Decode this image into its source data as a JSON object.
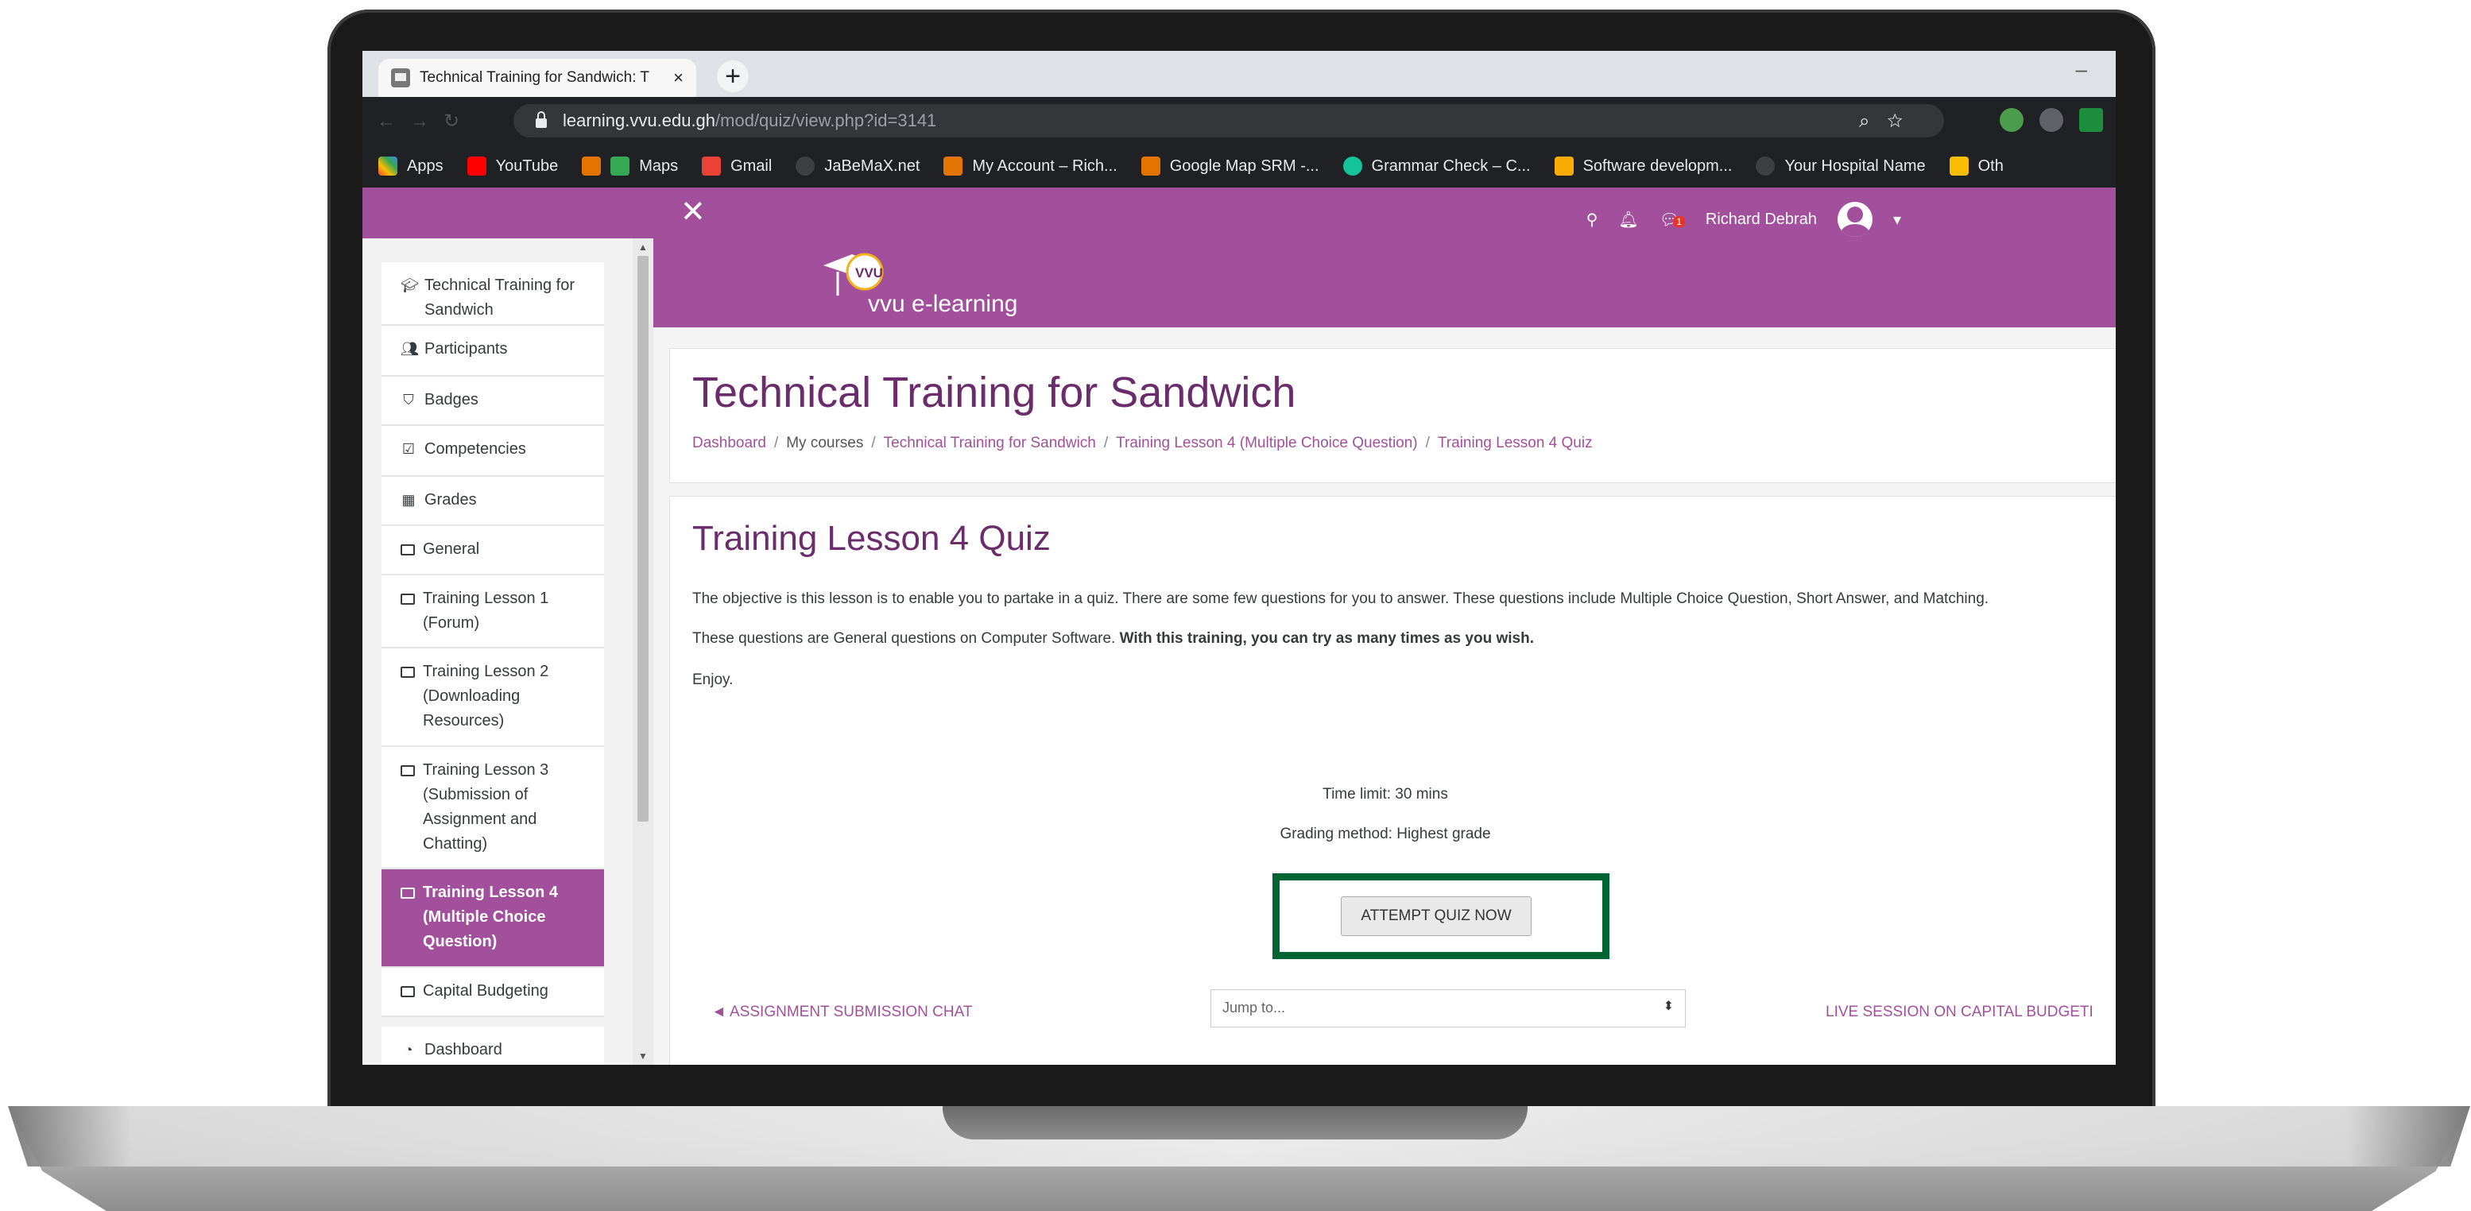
{
  "browser": {
    "tab_title": "Technical Training for Sandwich: T",
    "url_host": "learning.vvu.edu.gh",
    "url_path": "/mod/quiz/view.php?id=3141",
    "bookmarks": [
      "Apps",
      "YouTube",
      "Maps",
      "Gmail",
      "JaBeMaX.net",
      "My Account – Rich...",
      "Google Map SRM -...",
      "Grammar Check – C...",
      "Software developm...",
      "Your Hospital Name",
      "Oth"
    ]
  },
  "navbar": {
    "close_glyph": "✕",
    "user_name": "Richard Debrah",
    "message_count": "1"
  },
  "site": {
    "logo_badge": "VVU",
    "logo_text": "vvu e-learning"
  },
  "sidebar": {
    "items": [
      {
        "label": "Technical Training for Sandwich",
        "icon": "graduation-cap-icon"
      },
      {
        "label": "Participants",
        "icon": "users-icon"
      },
      {
        "label": "Badges",
        "icon": "shield-icon"
      },
      {
        "label": "Competencies",
        "icon": "checkbox-icon"
      },
      {
        "label": "Grades",
        "icon": "table-icon"
      },
      {
        "label": "General",
        "icon": "folder-icon"
      },
      {
        "label": "Training Lesson 1 (Forum)",
        "icon": "folder-icon"
      },
      {
        "label": "Training Lesson 2 (Downloading Resources)",
        "icon": "folder-icon"
      },
      {
        "label": "Training Lesson 3 (Submission of Assignment and Chatting)",
        "icon": "folder-icon"
      },
      {
        "label": "Training Lesson 4 (Multiple Choice Question)",
        "icon": "folder-icon"
      },
      {
        "label": "Capital Budgeting",
        "icon": "folder-icon"
      },
      {
        "label": "Dashboard",
        "icon": "dashboard-icon"
      }
    ]
  },
  "course": {
    "title": "Technical Training for Sandwich",
    "breadcrumb": [
      "Dashboard",
      "My courses",
      "Technical Training for Sandwich",
      "Training Lesson 4 (Multiple Choice Question)",
      "Training Lesson 4 Quiz"
    ]
  },
  "quiz": {
    "title": "Training Lesson 4 Quiz",
    "intro_1": "The objective is this lesson is to enable you to partake in a quiz. There are some few questions for you to answer. These questions include Multiple Choice Question, Short Answer, and Matching.",
    "intro_2_plain": "These questions are General questions on Computer Software. ",
    "intro_2_bold": "With this training, you can try as many times as you wish.",
    "intro_3": "Enjoy.",
    "time_limit": "Time limit: 30 mins",
    "grading_method": "Grading method: Highest grade",
    "attempt_button": "ATTEMPT QUIZ NOW",
    "prev_activity": "◄ ASSIGNMENT SUBMISSION CHAT",
    "jump_placeholder": "Jump to...",
    "next_activity": "LIVE SESSION ON CAPITAL BUDGETI"
  },
  "colors": {
    "brand": "#a3509c",
    "highlight": "#006532"
  }
}
